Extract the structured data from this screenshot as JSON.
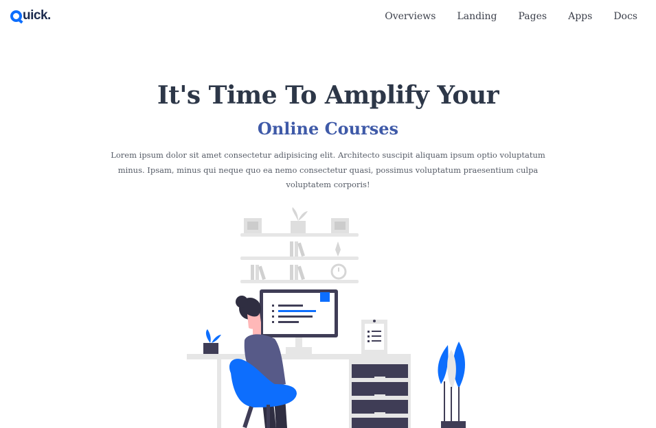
{
  "brand": {
    "logo_text": "Quick.",
    "logo_rest": "uick."
  },
  "nav": {
    "items": [
      {
        "label": "Overviews"
      },
      {
        "label": "Landing"
      },
      {
        "label": "Pages"
      },
      {
        "label": "Apps"
      },
      {
        "label": "Docs"
      }
    ]
  },
  "hero": {
    "title": "It's Time To Amplify Your",
    "subtitle": "Online Courses",
    "description": "Lorem ipsum dolor sit amet consectetur adipisicing elit. Architecto suscipit aliquam ipsum optio voluptatum minus. Ipsam, minus qui neque quo ea nemo consectetur quasi, possimus voluptatum praesentium culpa voluptatem corporis!"
  },
  "colors": {
    "accent": "#0d6efd",
    "title": "#2d3748",
    "subtitle": "#3f5aa8",
    "shelf_gray": "#e6e6e6",
    "drawer_dark": "#3f3d56"
  },
  "illustration": {
    "icon": "woman-at-desk-illustration"
  }
}
